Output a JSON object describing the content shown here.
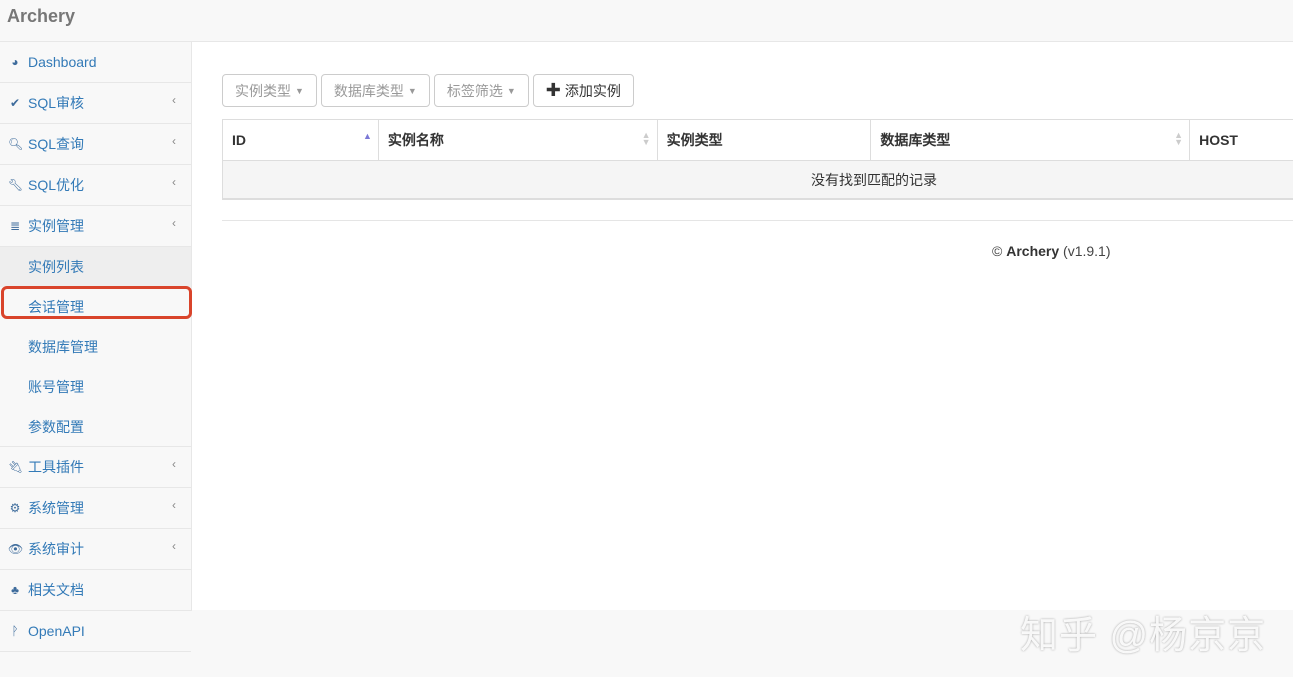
{
  "app": {
    "title": "Archery"
  },
  "sidebar": {
    "items_top": [
      {
        "label": "Dashboard",
        "icon": "dashboard-icon",
        "glyph": "◕",
        "chevron": false
      },
      {
        "label": "SQL审核",
        "icon": "check-icon",
        "glyph": "✔",
        "chevron": true
      },
      {
        "label": "SQL查询",
        "icon": "search-icon",
        "glyph": "🔍︎",
        "chevron": true
      },
      {
        "label": "SQL优化",
        "icon": "wrench-icon",
        "glyph": "🔧︎",
        "chevron": true
      },
      {
        "label": "实例管理",
        "icon": "database-icon",
        "glyph": "≣",
        "chevron": true
      }
    ],
    "sub_items": [
      {
        "label": "实例列表",
        "active": true
      },
      {
        "label": "会话管理"
      },
      {
        "label": "数据库管理"
      },
      {
        "label": "账号管理"
      },
      {
        "label": "参数配置"
      }
    ],
    "items_bottom": [
      {
        "label": "工具插件",
        "icon": "plug-icon",
        "glyph": "🔌︎",
        "chevron": true
      },
      {
        "label": "系统管理",
        "icon": "cogs-icon",
        "glyph": "⚙",
        "chevron": true
      },
      {
        "label": "系统审计",
        "icon": "eye-icon",
        "glyph": "👁︎",
        "chevron": true
      },
      {
        "label": "相关文档",
        "icon": "sitemap-icon",
        "glyph": "♣",
        "chevron": false
      },
      {
        "label": "OpenAPI",
        "icon": "code-fork-icon",
        "glyph": "ᚹ",
        "chevron": false
      }
    ],
    "chevron_glyph": "‹"
  },
  "toolbar": {
    "filter_instance_type": "实例类型",
    "filter_db_type": "数据库类型",
    "filter_tags": "标签筛选",
    "add_instance": "添加实例",
    "caret": "▼",
    "plus": "✚"
  },
  "table": {
    "columns": [
      {
        "label": "ID",
        "sort": "asc"
      },
      {
        "label": "实例名称",
        "sort": "both"
      },
      {
        "label": "实例类型",
        "sort": "none"
      },
      {
        "label": "数据库类型",
        "sort": "both"
      },
      {
        "label": "HOST",
        "sort": "none"
      }
    ],
    "empty_message": "没有找到匹配的记录"
  },
  "footer": {
    "copyright": "©",
    "brand": "Archery",
    "version": "(v1.9.1)"
  },
  "watermark": "知乎 @杨京京",
  "colors": {
    "link": "#337ab7",
    "highlight_box": "#d9442b",
    "sort_active": "#7b78d6"
  }
}
